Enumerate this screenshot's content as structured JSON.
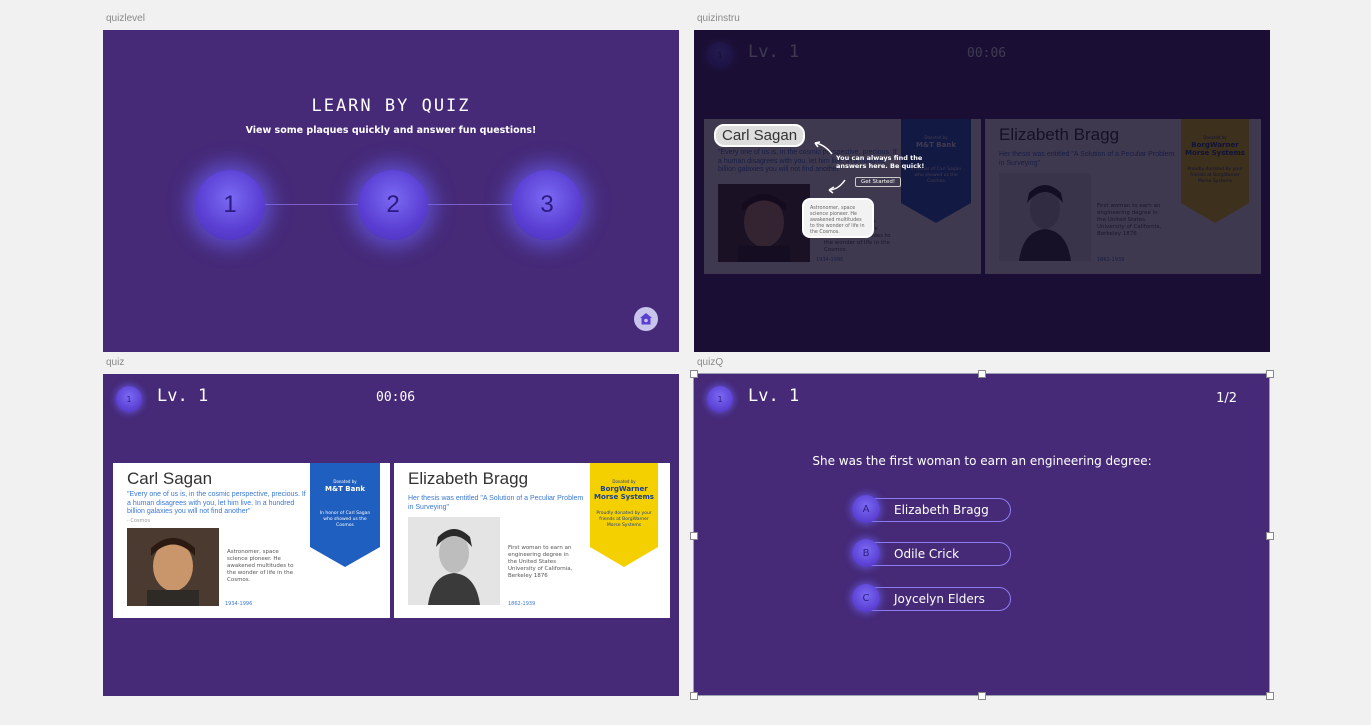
{
  "artboards": {
    "quizlevel": "quizlevel",
    "quizinstru": "quizinstru",
    "quiz": "quiz",
    "quizQ": "quizQ"
  },
  "quizlevel": {
    "title": "LEARN BY QUIZ",
    "subtitle": "View some plaques quickly and answer fun questions!",
    "levels": [
      "1",
      "2",
      "3"
    ],
    "home_icon": "home-icon"
  },
  "header": {
    "badge": "1",
    "level": "Lv. 1",
    "timer": "00:06"
  },
  "cards": [
    {
      "name": "Carl Sagan",
      "quote": "\"Every one of us is, in the cosmic perspective, precious. If a human disagrees with you, let him live. In a hundred billion galaxies you will not find another\"",
      "quote_source": "- Cosmos",
      "description": "Astronomer, space science pioneer. He awakened multitudes to the wonder of life in the Cosmos.",
      "years": "1934-1996",
      "sponsor_small": "Donated by",
      "sponsor": "M&T Bank",
      "sponsor_text": "In honor of Carl Sagan who showed us the Cosmos",
      "banner_color": "#1f5fbf",
      "banner_text_color": "#ffffff"
    },
    {
      "name": "Elizabeth Bragg",
      "quote": "Her thesis was entitled \"A Solution of a Peculiar Problem in Surveying\"",
      "description": "First woman to earn an engineering degree in the United States University of California, Berkeley 1876",
      "years": "1862-1939",
      "sponsor_small": "Donated by",
      "sponsor": "BorgWarner Morse Systems",
      "sponsor_text": "Proudly donated by your friends at BorgWarner Morse Systems",
      "banner_color": "#f5d000",
      "banner_text_color": "#1a3f8f"
    }
  ],
  "instructions": {
    "hint": "You can always find the answers here. Be quick!",
    "start_button": "Get Started!"
  },
  "quizQ": {
    "progress": "1/2",
    "question": "She was the first woman to earn an engineering degree:",
    "answers": [
      {
        "letter": "A",
        "label": "Elizabeth Bragg"
      },
      {
        "letter": "B",
        "label": "Odile Crick"
      },
      {
        "letter": "C",
        "label": "Joycelyn Elders"
      }
    ]
  }
}
